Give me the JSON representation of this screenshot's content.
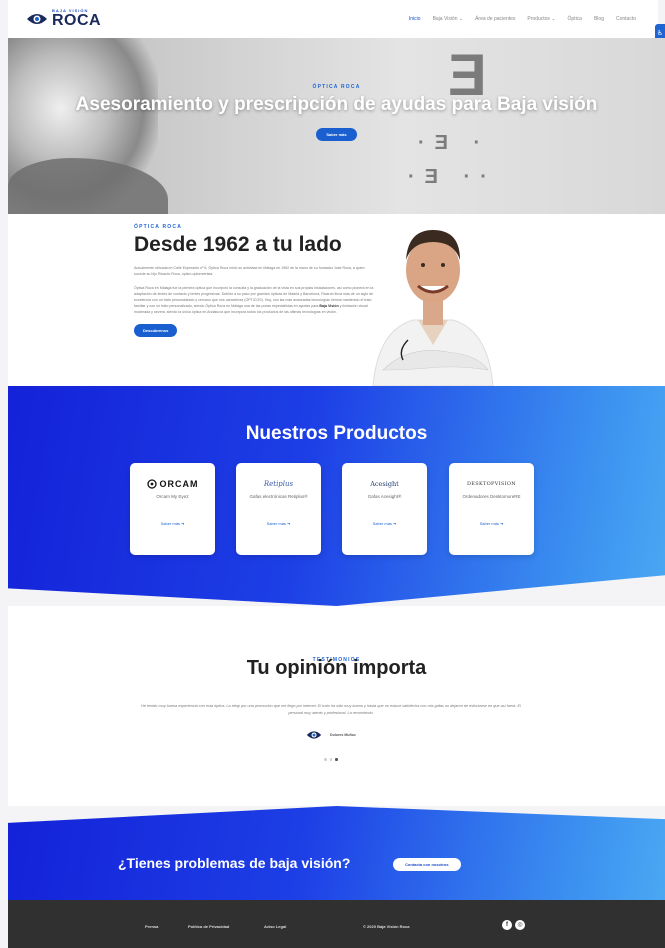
{
  "nav": {
    "logo_small": "BAJA VISIÓN",
    "logo_big": "ROCA",
    "items": [
      "Inicio",
      "Baja Visión",
      "Área de pacientes",
      "Productos",
      "Óptica",
      "Blog",
      "Contacto"
    ],
    "side_tab_icon": "accessibility-icon"
  },
  "hero": {
    "kicker": "ÓPTICA ROCA",
    "title": "Asesoramiento y prescripción de ayudas para Baja visión",
    "button": "Saber más"
  },
  "about": {
    "kicker": "ÓPTICA ROCA",
    "title": "Desde 1962 a tu lado",
    "para1": "Actualmente ubicada en Calle Esperanto nº 6, Óptica Roca inició su actividad en Málaga en 1962 de la mano de su fundador José Roca, a quien sucede su hijo Ricardo Roca, óptico-optometrista.",
    "para2_a": "Óptica Roca en Málaga fue la primera óptica que incorporó la consulta y la graduación de la vista en sus propias instalaciones, así como pionera en la adaptación de lentes de contacto y lentes progresivas. Debido a su paso por grandes ópticas de Madrid y Barcelona, Ricardo lleva más de un siglo de excelencia con un trato personalizado y cercano que nos caracteriza (ÓPTICOS). Hoy, con las más avanzadas tecnologías hemos mantenido el trato familiar y con un trato personalizado, siendo Óptica Roca en Málaga una de las pocas especialistas en ayudas para",
    "para2_b": "Baja Visión",
    "para2_c": "y limitación visual moderada y severa, siendo la única óptica en Andalucía que incorpora todos los productos de las últimas tecnologías en visión.",
    "button": "Descúbrenos"
  },
  "products": {
    "title": "Nuestros Productos",
    "cards": [
      {
        "logo": "ORCAM",
        "name": "Orcam My Eye2",
        "link": "Saber más"
      },
      {
        "logo": "Retiplus",
        "name": "Gafas electrónicas Retiplus®",
        "link": "Saber más"
      },
      {
        "logo": "Acesight",
        "name": "Gafas Acesight®",
        "link": "Saber más"
      },
      {
        "logo": "DESKTOPVISION",
        "name": "Ordenadores DesktomoreRE",
        "link": "Saber más"
      }
    ]
  },
  "testimonials": {
    "kicker": "TESTIMONIOS",
    "title": "Tu opinión importa",
    "quote": "He tenido muy buena experiencia con esta óptica. La elegí por una promoción que me llegó por internet. El trato ha sido muy bueno y hasta que no estuve satisfecha con mis gafas no dejaron de esforzarse en que así fuera. El personal muy atento y profesional. La recomiendo.",
    "author": "Dolores Muñoz"
  },
  "cta": {
    "title": "¿Tienes problemas de baja visión?",
    "button": "Contacta con nosotros"
  },
  "footer": {
    "links": [
      "Prensa",
      "Política de Privacidad",
      "Aviso Legal"
    ],
    "copyright": "© 2020 Baja Visión Roca",
    "social": [
      "facebook-icon",
      "instagram-icon"
    ]
  },
  "colors": {
    "brand_blue": "#1e50c8",
    "gradient_start": "#1422d8",
    "gradient_end": "#4aa8f3",
    "footer_bg": "#303030"
  }
}
